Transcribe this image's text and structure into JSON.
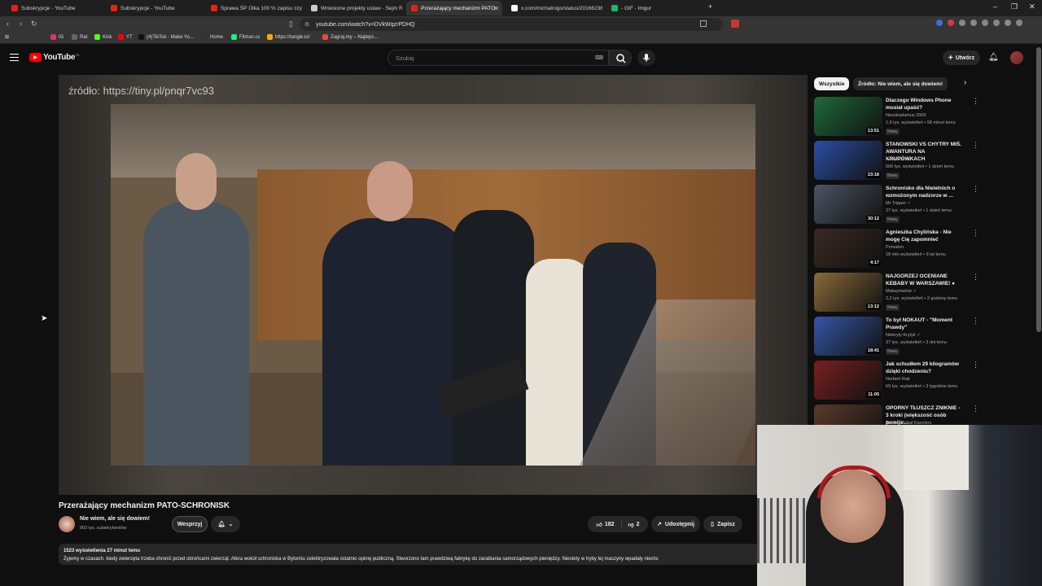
{
  "browser": {
    "tabs": [
      {
        "label": "Subskrypcje - YouTube",
        "color": "#e62117"
      },
      {
        "label": "Subskrypcje - YouTube",
        "color": "#e62117"
      },
      {
        "label": "Sprawa ŚP Olka 100 % zapisu czynn",
        "color": "#e62117"
      },
      {
        "label": "Wniesione projekty ustaw - Sejm Rz",
        "color": "#cccccc"
      },
      {
        "label": "Przerażający mechanizm PATO",
        "color": "#e62117"
      },
      {
        "label": "x.com/michalrogo/status/20166238",
        "color": "#ffffff"
      },
      {
        "label": "- GIF - Imgur",
        "color": "#1bb76e"
      }
    ],
    "new_tab": "+",
    "url": "youtube.com/watch?v=DVkWqzrPDHQ",
    "bookmarks": [
      "IG",
      "Rat",
      "Kick",
      "YT",
      "(4)TikTok - Make Yo...",
      "Home",
      "Filman.cc",
      "https://tangle.io/",
      "Zagraj.my – Najleps..."
    ]
  },
  "youtube": {
    "logo": "YouTube",
    "country": "PL",
    "search_placeholder": "Szukaj",
    "create_label": "Utwórz"
  },
  "video": {
    "overlay_text": "źródło: https://tiny.pl/pnqr7vc93",
    "title": "Przerażający mechanizm PATO-SCHRONISK",
    "channel": "Nie wiem, ale się dowiem!",
    "subscribers": "903 tys. subskrybentów",
    "support_label": "Wesprzyj",
    "likes": "182",
    "dislikes": "2",
    "share_label": "Udostępnij",
    "save_label": "Zapisz",
    "views_time": "1523 wyświetlenia  27 minut temu",
    "description": "Żyjemy w czasach, kiedy zwierzęta trzeba chronić przed obrońcami zwierząt. Afera wokół schroniska w Bytomiu zelektryzowała ostatnio opinię publiczną. Stworzono tam prawdziwą fabrykę do zarabiania samorządowych pieniędzy. Niestety w tryby tej maszyny wpadały niechc"
  },
  "chips": [
    "Wszystkie",
    "Źródło: Nie wiem, ale się dowiem!"
  ],
  "recommendations": [
    {
      "title": "Dlaczego Windows Phone musiał upaść?",
      "channel": "Neostradamus 2000",
      "meta": "1,6 tys. wyświetleń • 58 minut temu",
      "badge": "Nowy",
      "duration": "13:51",
      "thumb": "#1d6a3a"
    },
    {
      "title": "STANOWSKI VS CHYTRY MIŚ. AWANTURA NA KRUPÓWKACH",
      "channel": "Kanał Zero ✓",
      "meta": "606 tys. wyświetleń • 1 dzień temu",
      "badge": "Nowy",
      "duration": "23:18",
      "thumb": "#2a4fa6"
    },
    {
      "title": "Schronisko dla Nieletnich o wzmożonym nadzorze w ...",
      "channel": "Mr Tripper ✓",
      "meta": "27 tys. wyświetleń • 1 dzień temu",
      "badge": "Nowy",
      "duration": "30:12",
      "thumb": "#4b5563"
    },
    {
      "title": "Agnieszka Chylińska - Nie mogę Cię zapomnieć",
      "channel": "Pomaton",
      "meta": "18 mln wyświetleń • 9 lat temu",
      "badge": "",
      "duration": "4:17",
      "thumb": "#3a2a22"
    },
    {
      "title": "NAJGORZEJ OCENIANE KEBABY W WARSZAWIE! ●",
      "channel": "Maksymalnie ✓",
      "meta": "2,2 tys. wyświetleń • 2 godziny temu",
      "badge": "Nowy",
      "duration": "13:12",
      "thumb": "#8a6a3a"
    },
    {
      "title": "To był NOKAUT - \"Moment Prawdy\"",
      "channel": "Niekryty Krytyk ✓",
      "meta": "37 tys. wyświetleń • 3 dni temu",
      "badge": "Nowy",
      "duration": "18:41",
      "thumb": "#3456a8"
    },
    {
      "title": "Jak schudłem 29 kilogramów dzięki chodzeniu?",
      "channel": "Norbert Rak",
      "meta": "69 tys. wyświetleń • 3 tygodnie temu",
      "badge": "",
      "duration": "11:05",
      "thumb": "#7a1f1f"
    },
    {
      "title": "OPORNY TŁUSZCZ ZNIKNIE - 3 kroki (większość osób pomija ...",
      "channel": "Trener Michał Kanclerz",
      "meta": "",
      "badge": "",
      "duration": "",
      "thumb": "#5a3a2a"
    }
  ],
  "colors": {
    "brand": "#ff0000",
    "bg": "#0f0f0f",
    "surface": "#272727"
  }
}
